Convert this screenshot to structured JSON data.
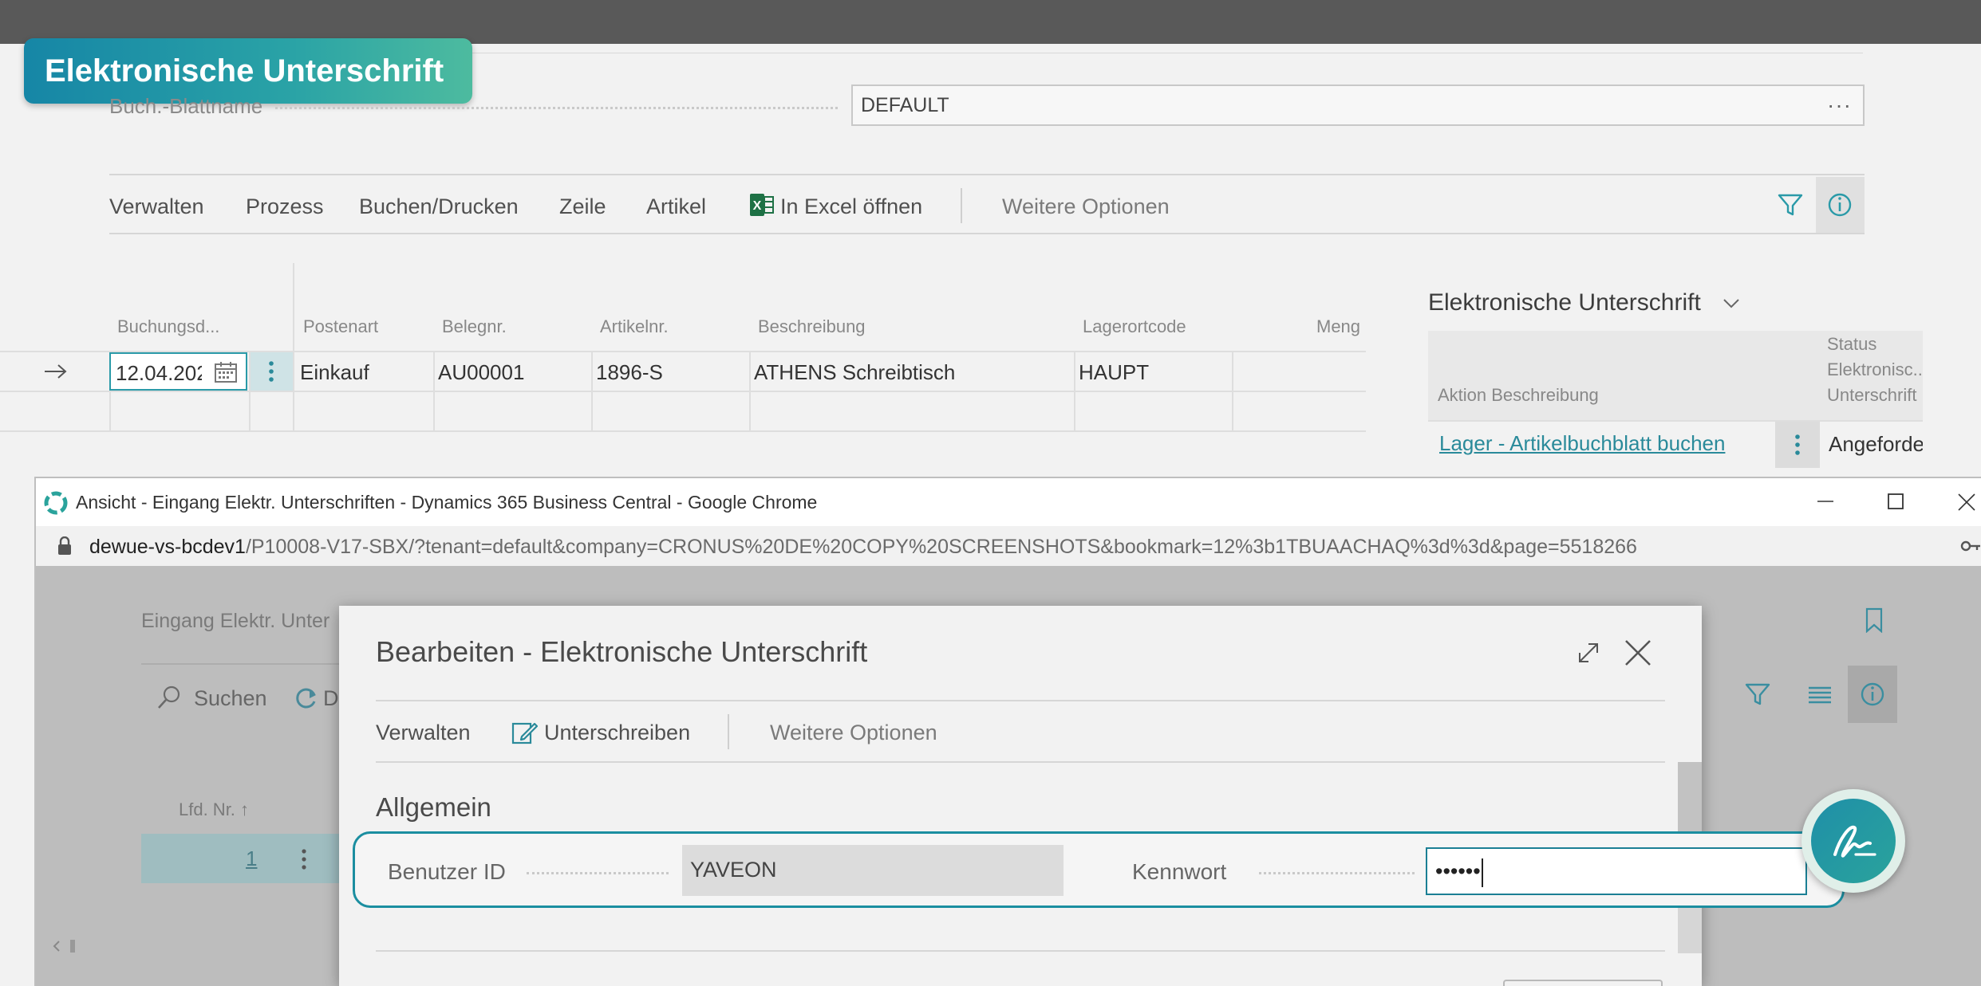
{
  "badge": {
    "title": "Elektronische Unterschrift"
  },
  "journal": {
    "name_label": "Buch.-Blattname",
    "name_value": "DEFAULT",
    "lookup_glyph": "···"
  },
  "actions": {
    "items": [
      "Verwalten",
      "Prozess",
      "Buchen/Drucken",
      "Zeile",
      "Artikel"
    ],
    "excel": "In Excel öffnen",
    "more": "Weitere Optionen"
  },
  "grid": {
    "columns": [
      "Buchungsd...",
      "Postenart",
      "Belegnr.",
      "Artikelnr.",
      "Beschreibung",
      "Lagerortcode",
      "Meng"
    ],
    "rows": [
      {
        "date": "12.04.202",
        "entry_type": "Einkauf",
        "doc_no": "AU00001",
        "item_no": "1896-S",
        "description": "ATHENS Schreibtisch",
        "location": "HAUPT"
      }
    ]
  },
  "factbox": {
    "title": "Elektronische Unterschrift",
    "col_action": "Aktion Beschreibung",
    "col_status_1": "Status",
    "col_status_2": "Elektronisc...",
    "col_status_3": "Unterschrift",
    "row_action": "Lager - Artikelbuchblatt buchen",
    "row_status": "Angeforde"
  },
  "chrome": {
    "title": "Ansicht - Eingang Elektr. Unterschriften - Dynamics 365 Business Central - Google Chrome",
    "url_host": "dewue-vs-bcdev1",
    "url_path": "/P10008-V17-SBX/?tenant=default&company=CRONUS%20DE%20COPY%20SCREENSHOTS&bookmark=12%3b1TBUAACHAQ%3d%3d&page=5518266"
  },
  "behind_page": {
    "title": "Eingang Elektr. Unter",
    "search": "Suchen",
    "col_lfd": "Lfd. Nr. ↑",
    "row_no": "1"
  },
  "dialog": {
    "title": "Bearbeiten - Elektronische Unterschrift",
    "action_manage": "Verwalten",
    "action_sign": "Unterschreiben",
    "action_more": "Weitere Optionen",
    "section": "Allgemein",
    "user_label": "Benutzer ID",
    "user_value": "YAVEON",
    "password_label": "Kennwort",
    "password_value": "••••••"
  },
  "colors": {
    "accent": "#1b8ea0",
    "badge_start": "#1686a6",
    "badge_end": "#4dbb9f",
    "link": "#2a8a9a"
  }
}
